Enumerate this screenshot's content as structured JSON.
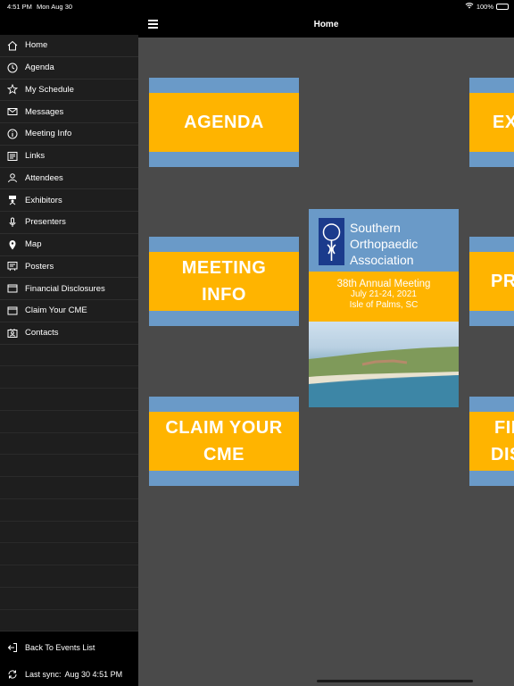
{
  "status": {
    "time": "4:51 PM",
    "date": "Mon Aug 30",
    "battery": "100%"
  },
  "header": {
    "title": "Home"
  },
  "sidebar": {
    "items": [
      {
        "label": "Home"
      },
      {
        "label": "Agenda"
      },
      {
        "label": "My Schedule"
      },
      {
        "label": "Messages"
      },
      {
        "label": "Meeting Info"
      },
      {
        "label": "Links"
      },
      {
        "label": "Attendees"
      },
      {
        "label": "Exhibitors"
      },
      {
        "label": "Presenters"
      },
      {
        "label": "Map"
      },
      {
        "label": "Posters"
      },
      {
        "label": "Financial Disclosures"
      },
      {
        "label": "Claim Your CME"
      },
      {
        "label": "Contacts"
      }
    ],
    "footer": {
      "back_label": "Back To Events List",
      "sync_label": "Last sync:",
      "sync_time": "Aug 30 4:51 PM"
    }
  },
  "tiles": [
    {
      "line1": "AGENDA",
      "line2": ""
    },
    {
      "line1": "EX",
      "line2": ""
    },
    {
      "line1": "MEETING",
      "line2": "INFO"
    },
    {
      "line1": "PR",
      "line2": ""
    },
    {
      "line1": "CLAIM YOUR",
      "line2": "CME"
    },
    {
      "line1": "FIN",
      "line2": "DISC"
    }
  ],
  "poster": {
    "org_line1": "Southern",
    "org_line2": "Orthopaedic",
    "org_line3": "Association",
    "meeting": "38th Annual Meeting",
    "dates": "July 21-24, 2021",
    "location": "Isle of Palms, SC"
  },
  "colors": {
    "tile_band": "#ffb400",
    "tile_frame": "#6a9ac8",
    "background": "#4a4a4a"
  }
}
